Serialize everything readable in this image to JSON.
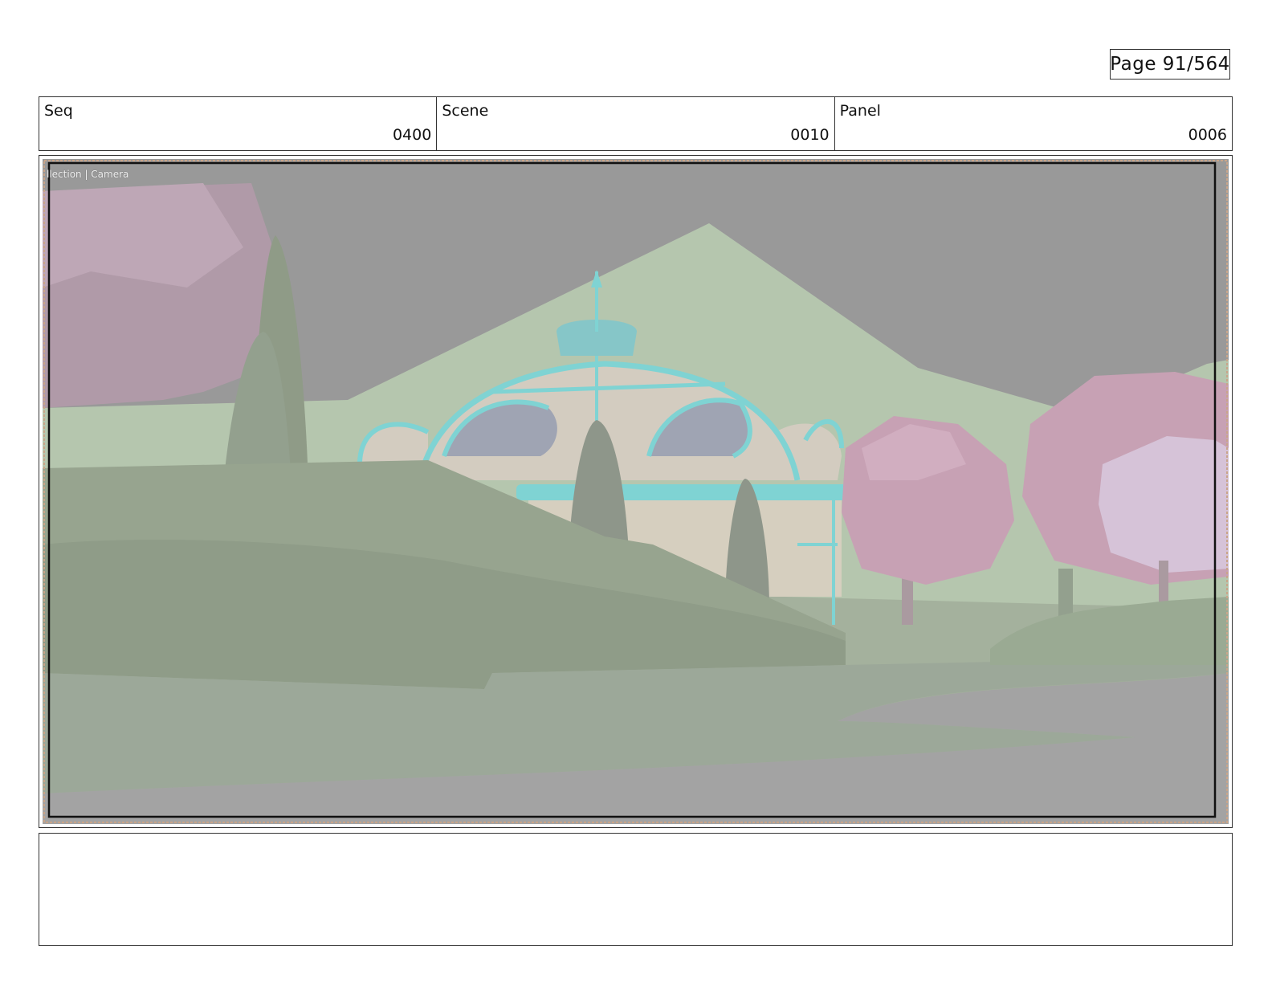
{
  "page": {
    "label": "Page",
    "number": "91/564"
  },
  "header": {
    "seq": {
      "label": "Seq",
      "value": "0400"
    },
    "scene": {
      "label": "Scene",
      "value": "0010"
    },
    "panel": {
      "label": "Panel",
      "value": "0006"
    }
  },
  "viewport": {
    "overlay_text": "llection | Camera"
  },
  "notes": {
    "text": ""
  },
  "colors": {
    "sky": "#999999",
    "mountain": "#b5c6ae",
    "grass": "#95a58d",
    "trim": "#7fd3d3",
    "dome": "#d3ccc0",
    "blossom": "#c7a1b4",
    "blossom_light": "#d6c3d8"
  }
}
